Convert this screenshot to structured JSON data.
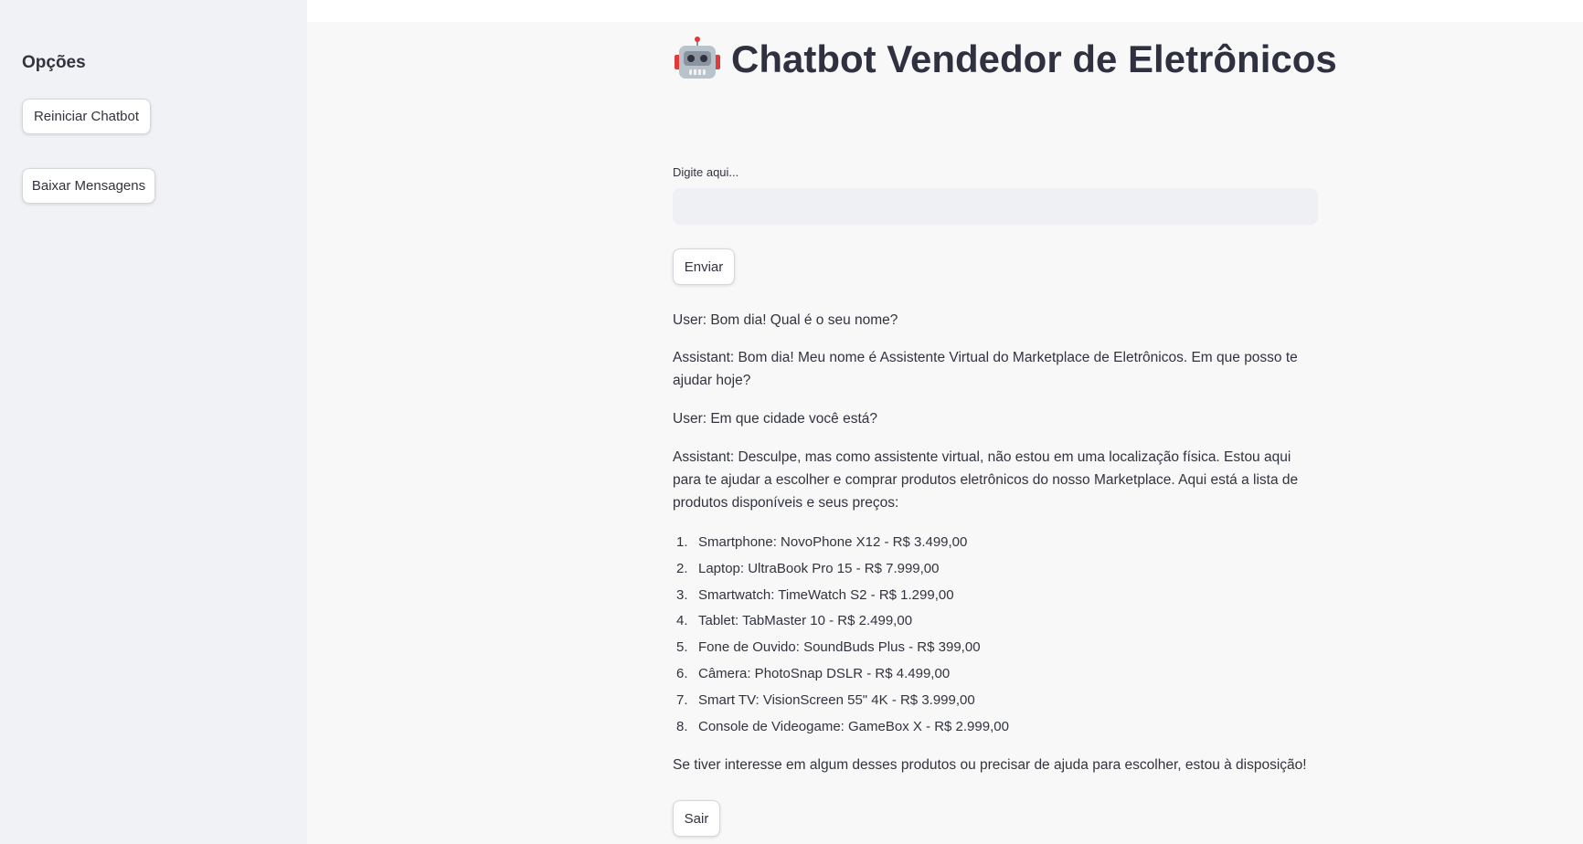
{
  "sidebar": {
    "title": "Opções",
    "restart_label": "Reiniciar Chatbot",
    "download_label": "Baixar Mensagens"
  },
  "header": {
    "icon": "robot-icon",
    "title": "Chatbot Vendedor de Eletrônicos"
  },
  "input": {
    "label": "Digite aqui...",
    "value": "",
    "placeholder": ""
  },
  "send_label": "Enviar",
  "chat": {
    "msg1": "User: Bom dia! Qual é o seu nome?",
    "msg2": "Assistant: Bom dia! Meu nome é Assistente Virtual do Marketplace de Eletrônicos. Em que posso te ajudar hoje?",
    "msg3": "User: Em que cidade você está?",
    "msg4": "Assistant: Desculpe, mas como assistente virtual, não estou em uma localização física. Estou aqui para te ajudar a escolher e comprar produtos eletrônicos do nosso Marketplace. Aqui está a lista de produtos disponíveis e seus preços:",
    "products": [
      {
        "num": "1.",
        "text": "Smartphone: NovoPhone X12 - R$ 3.499,00"
      },
      {
        "num": "2.",
        "text": "Laptop: UltraBook Pro 15 - R$ 7.999,00"
      },
      {
        "num": "3.",
        "text": "Smartwatch: TimeWatch S2 - R$ 1.299,00"
      },
      {
        "num": "4.",
        "text": "Tablet: TabMaster 10 - R$ 2.499,00"
      },
      {
        "num": "5.",
        "text": "Fone de Ouvido: SoundBuds Plus - R$ 399,00"
      },
      {
        "num": "6.",
        "text": "Câmera: PhotoSnap DSLR - R$ 4.499,00"
      },
      {
        "num": "7.",
        "text": "Smart TV: VisionScreen 55\" 4K - R$ 3.999,00"
      },
      {
        "num": "8.",
        "text": "Console de Videogame: GameBox X - R$ 2.999,00"
      }
    ],
    "msg5": "Se tiver interesse em algum desses produtos ou precisar de ajuda para escolher, estou à disposição!"
  },
  "exit_label": "Sair"
}
